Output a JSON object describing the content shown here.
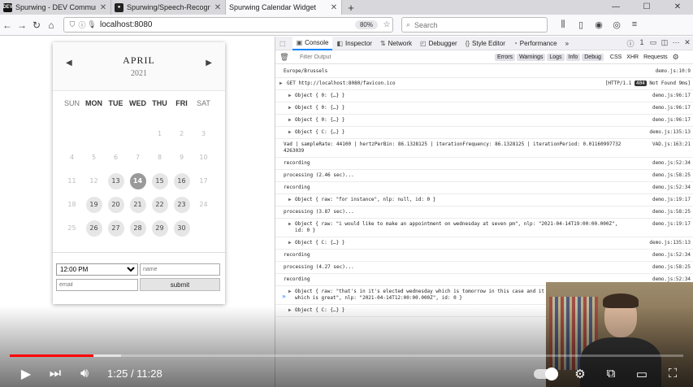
{
  "browser": {
    "tabs": [
      {
        "favicon": "DEV",
        "title": "Spurwing - DEV Community",
        "active": false
      },
      {
        "favicon": "github-icon",
        "title": "Spurwing/Speech-Recognition",
        "active": false
      },
      {
        "favicon": "",
        "title": "Spurwing Calendar Widget",
        "active": true
      }
    ],
    "new_tab": "+",
    "url": "localhost:8080",
    "zoom": "80%",
    "search_placeholder": "Search"
  },
  "calendar": {
    "month": "APRIL",
    "year": "2021",
    "weekdays": [
      "SUN",
      "MON",
      "TUE",
      "WED",
      "THU",
      "FRI",
      "SAT"
    ],
    "weeks": [
      [
        null,
        null,
        null,
        null,
        1,
        2,
        3
      ],
      [
        4,
        5,
        6,
        7,
        8,
        9,
        10
      ],
      [
        11,
        12,
        13,
        14,
        15,
        16,
        17
      ],
      [
        18,
        19,
        20,
        21,
        22,
        23,
        24
      ],
      [
        25,
        26,
        27,
        28,
        29,
        30,
        null
      ]
    ],
    "available_days": [
      13,
      15,
      16,
      19,
      20,
      21,
      22,
      23,
      26,
      27,
      28,
      29,
      30
    ],
    "selected_day": 14,
    "time_value": "12:00 PM",
    "name_placeholder": "name",
    "email_placeholder": "email",
    "submit_label": "submit"
  },
  "devtools": {
    "tabs": [
      {
        "icon": "inspector-icon",
        "label": ""
      },
      {
        "icon": "console-icon",
        "label": "Console"
      },
      {
        "icon": "inspector-icon",
        "label": "Inspector"
      },
      {
        "icon": "network-icon",
        "label": "Network"
      },
      {
        "icon": "debugger-icon",
        "label": "Debugger"
      },
      {
        "icon": "style-editor-icon",
        "label": "Style Editor"
      },
      {
        "icon": "performance-icon",
        "label": "Performance"
      }
    ],
    "error_count": "1",
    "filter_placeholder": "Filter Output",
    "filter_buttons": [
      "Errors",
      "Warnings",
      "Logs",
      "Info",
      "Debug"
    ],
    "extra_filters": [
      "CSS",
      "XHR",
      "Requests"
    ],
    "log": [
      {
        "kind": "plain",
        "text": "Europe/Brussels",
        "src": "demo.js:10:9"
      },
      {
        "kind": "net",
        "text": "GET http://localhost:8080/favicon.ico",
        "http": "[HTTP/1.1",
        "status": "404",
        "status_text": "Not Found 9ms]"
      },
      {
        "kind": "obj",
        "text": "Object { 0: {…} }",
        "src": "demo.js:96:17"
      },
      {
        "kind": "obj",
        "text": "Object { 0: {…} }",
        "src": "demo.js:96:17"
      },
      {
        "kind": "obj",
        "text": "Object { 0: {…} }",
        "src": "demo.js:96:17"
      },
      {
        "kind": "obj",
        "text": "Object { C: {…} }",
        "src": "demo.js:135:13"
      },
      {
        "kind": "plain",
        "text": "Vad | sampleRate: 44100 | hertzPerBin: 86.1328125 | iterationFrequency: 86.1328125 | iterationPeriod: 0.011609977324263039",
        "src": "VAD.js:163:21"
      },
      {
        "kind": "plain",
        "text": "recording",
        "src": "demo.js:52:34"
      },
      {
        "kind": "plain",
        "text": "processing (2.46 sec)...",
        "src": "demo.js:58:25"
      },
      {
        "kind": "plain",
        "text": "recording",
        "src": "demo.js:52:34"
      },
      {
        "kind": "obj",
        "text": "Object { raw: \"for instance\", nlp: null, id: 0 }",
        "src": "demo.js:19:17"
      },
      {
        "kind": "plain",
        "text": "processing (3.87 sec)...",
        "src": "demo.js:58:25"
      },
      {
        "kind": "obj",
        "text": "Object { raw: \"i would like to make an appointment on wednesday at seven pm\", nlp: \"2021-04-14T19:00:00.000Z\", id: 0 }",
        "src": "demo.js:19:17"
      },
      {
        "kind": "obj",
        "text": "Object { C: {…} }",
        "src": "demo.js:135:13"
      },
      {
        "kind": "plain",
        "text": "recording",
        "src": "demo.js:52:34"
      },
      {
        "kind": "plain",
        "text": "processing (4.27 sec)...",
        "src": "demo.js:58:25"
      },
      {
        "kind": "plain",
        "text": "recording",
        "src": "demo.js:52:34"
      },
      {
        "kind": "obj",
        "text": "Object { raw: \"that's in it's elected wednesday which is tomorrow in this case and it selected seven pm is well which is great\", nlp: \"2021-04-14T12:00:00.000Z\", id: 0 }",
        "src": "demo.js:19:17"
      },
      {
        "kind": "obj",
        "text": "Object { C: {…} }",
        "src": ""
      }
    ],
    "prompt": "»"
  },
  "player": {
    "current_time": "1:25",
    "duration": "11:28",
    "progress": 0.124,
    "buffered": 0.165
  }
}
